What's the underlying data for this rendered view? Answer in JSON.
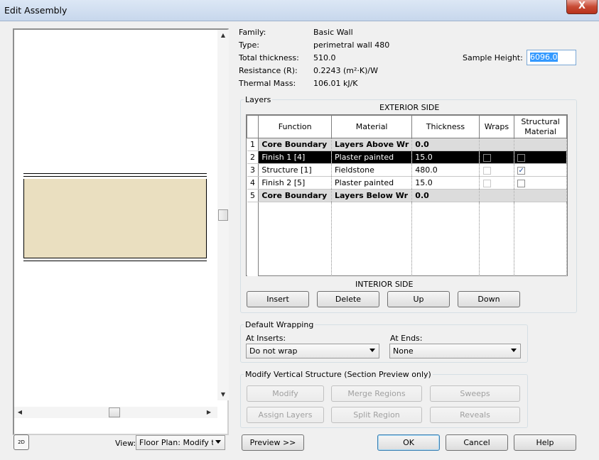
{
  "window": {
    "title": "Edit Assembly",
    "close_glyph": "X"
  },
  "properties": {
    "family_label": "Family:",
    "family_value": "Basic Wall",
    "type_label": "Type:",
    "type_value": "perimetral wall 480",
    "thickness_label": "Total thickness:",
    "thickness_value": "510.0",
    "resistance_label": "Resistance (R):",
    "resistance_value": "0.2243 (m²·K)/W",
    "mass_label": "Thermal Mass:",
    "mass_value": "106.01 kJ/K",
    "sample_height_label": "Sample Height:",
    "sample_height_value": "6096.0"
  },
  "layers": {
    "group_label": "Layers",
    "exterior_label": "EXTERIOR SIDE",
    "interior_label": "INTERIOR SIDE",
    "columns": [
      "Function",
      "Material",
      "Thickness",
      "Wraps",
      "Structural Material"
    ],
    "rows": [
      {
        "num": "1",
        "function": "Core Boundary",
        "material": "Layers Above Wr",
        "thickness": "0.0",
        "wraps": false,
        "structural": false
      },
      {
        "num": "2",
        "function": "Finish 1 [4]",
        "material": "Plaster painted",
        "thickness": "15.0",
        "wraps": false,
        "structural": false
      },
      {
        "num": "3",
        "function": "Structure [1]",
        "material": "Fieldstone",
        "thickness": "480.0",
        "wraps": false,
        "structural": true
      },
      {
        "num": "4",
        "function": "Finish 2 [5]",
        "material": "Plaster painted",
        "thickness": "15.0",
        "wraps": false,
        "structural": false
      },
      {
        "num": "5",
        "function": "Core Boundary",
        "material": "Layers Below Wr",
        "thickness": "0.0",
        "wraps": false,
        "structural": false
      }
    ],
    "buttons": {
      "insert": "Insert",
      "delete": "Delete",
      "up": "Up",
      "down": "Down"
    }
  },
  "wrapping": {
    "group_label": "Default Wrapping",
    "inserts_label": "At Inserts:",
    "inserts_value": "Do not wrap",
    "ends_label": "At Ends:",
    "ends_value": "None"
  },
  "vertical": {
    "group_label": "Modify Vertical Structure (Section Preview only)",
    "modify": "Modify",
    "merge": "Merge Regions",
    "sweeps": "Sweeps",
    "assign": "Assign Layers",
    "split": "Split Region",
    "reveals": "Reveals"
  },
  "footer": {
    "icon_label": "2D",
    "view_label": "View:",
    "view_value": "Floor Plan: Modify typ",
    "preview": "Preview >>",
    "ok": "OK",
    "cancel": "Cancel",
    "help": "Help"
  }
}
